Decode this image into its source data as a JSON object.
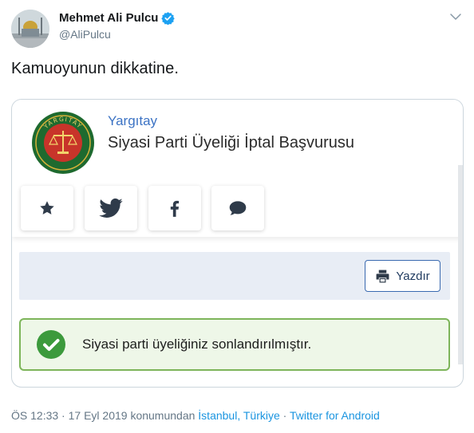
{
  "author": {
    "name": "Mehmet Ali Pulcu",
    "handle": "@AliPulcu",
    "avatar_icon": "mosque-avatar",
    "verified_icon": "verified-badge-icon"
  },
  "tweet": {
    "text": "Kamuoyunun dikkatine."
  },
  "media": {
    "org_name": "Yargıtay",
    "logo_text": "YARGITAY",
    "document_title": "Siyasi Parti Üyeliği İptal Başvurusu",
    "share_buttons": [
      {
        "icon": "star-icon"
      },
      {
        "icon": "twitter-icon"
      },
      {
        "icon": "facebook-icon"
      },
      {
        "icon": "comment-icon"
      }
    ],
    "print_label": "Yazdır",
    "alert_message": "Siyasi parti üyeliğiniz sonlandırılmıştır."
  },
  "meta": {
    "time": "ÖS 12:33",
    "sep1": " · ",
    "date": "17 Eyl 2019",
    "location_prefix": " konumundan ",
    "location": "İstanbul, Türkiye",
    "sep2": " · ",
    "source": "Twitter for Android"
  },
  "colors": {
    "link": "#1b95e0",
    "verified": "#1da1f2",
    "org_blue": "#3c73c4",
    "success_green": "#3c9a3c",
    "alert_border": "#7db55a"
  }
}
